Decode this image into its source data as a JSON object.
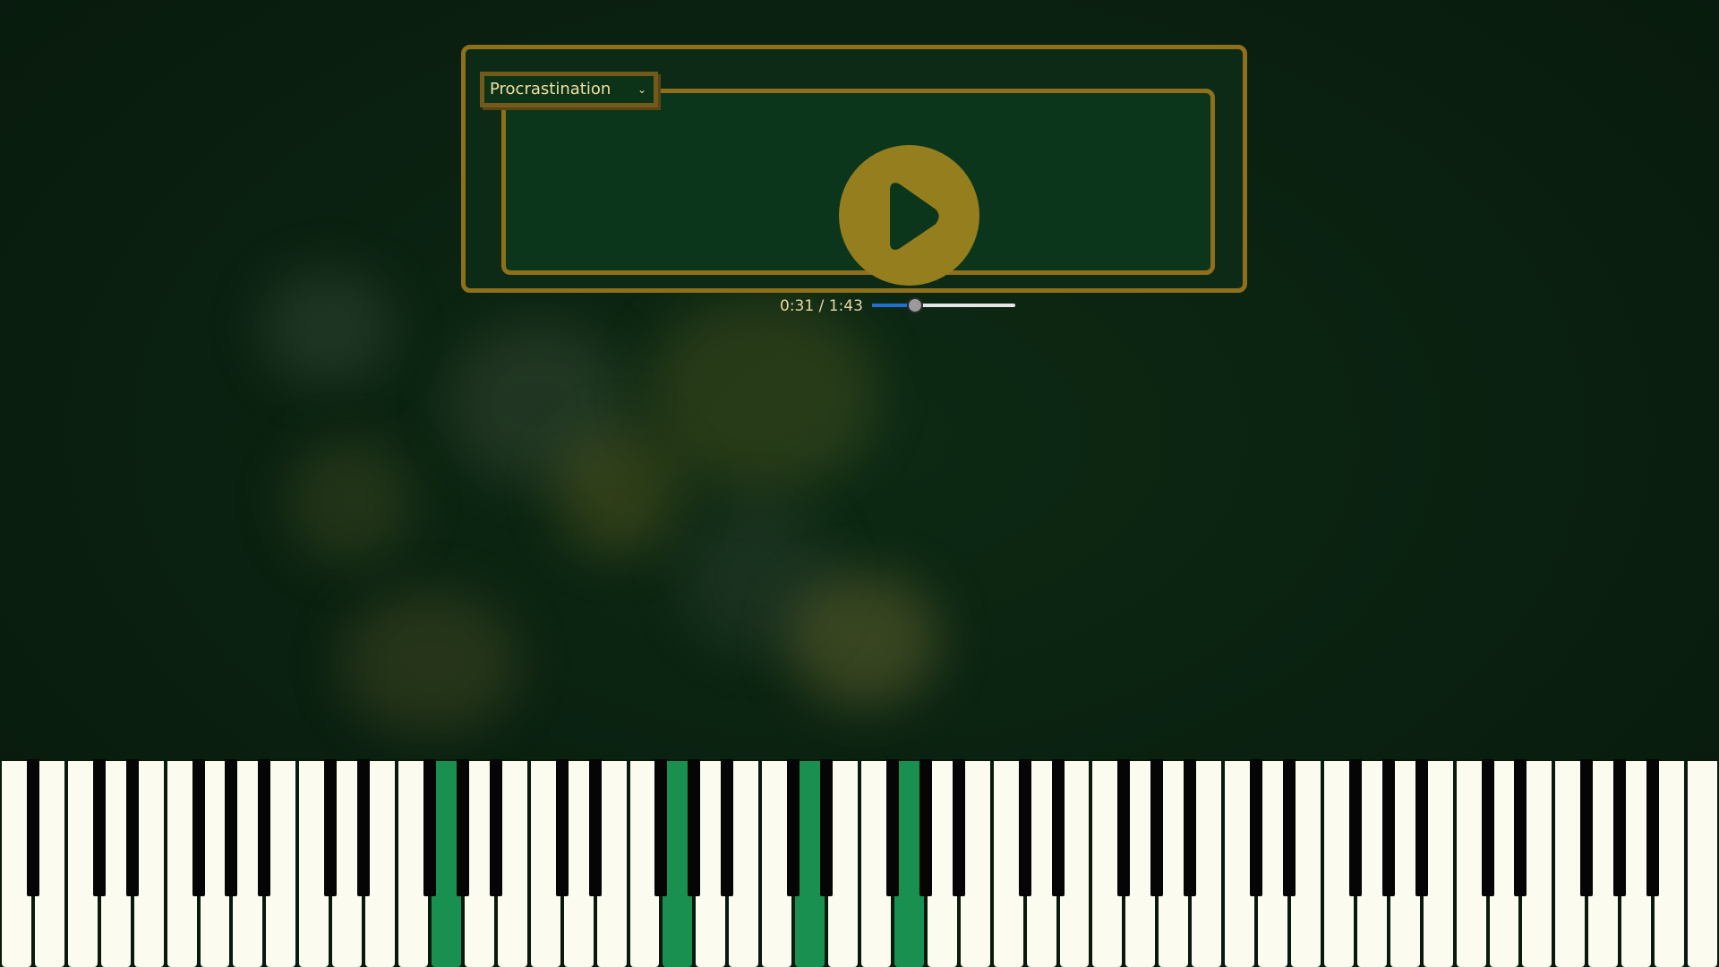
{
  "player": {
    "song_select": {
      "value": "Procrastination"
    },
    "play_icon": "play-icon",
    "time": {
      "current": "0:31",
      "total": "1:43",
      "display": "0:31 / 1:43"
    },
    "progress_fraction": 0.3
  },
  "colors": {
    "background": "#0a1f10",
    "panel_border": "#8e6f1a",
    "play_button": "#947e1e",
    "key_highlight": "#1a9050",
    "white_key": "#fbfbef",
    "black_key": "#050505",
    "progress_fill": "#1f6fd6"
  },
  "piano": {
    "white_key_count": 52,
    "active_white_keys": [
      13,
      20,
      24,
      27
    ],
    "active_black_keys": []
  }
}
